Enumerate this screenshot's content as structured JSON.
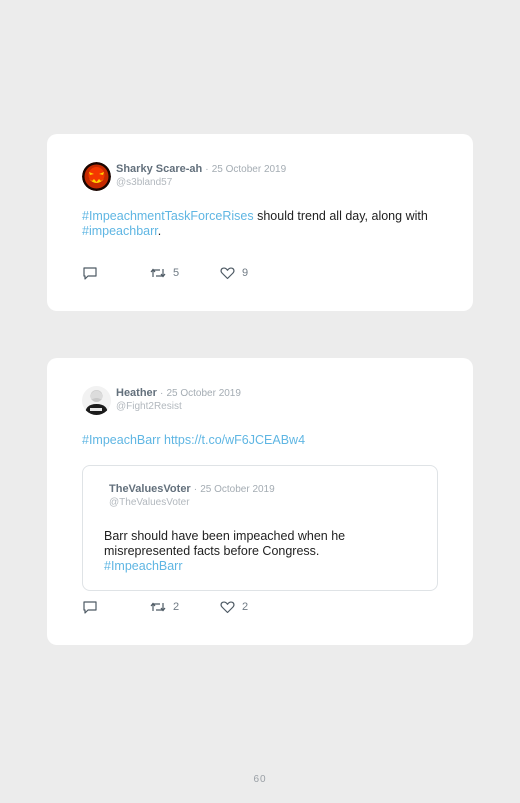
{
  "tweets": [
    {
      "author_name": "Sharky Scare-ah",
      "date": "25 October 2019",
      "handle": "@s3bland57",
      "text_parts": {
        "tag1": "#ImpeachmentTaskForceRises",
        "mid": " should trend all day, along with ",
        "tag2": "#impeachbarr",
        "end": "."
      },
      "replies": "",
      "retweets": "5",
      "likes": "9",
      "avatar_icon": "jack-o-lantern-avatar"
    },
    {
      "author_name": "Heather",
      "date": "25 October 2019",
      "handle": "@Fight2Resist",
      "text_parts": {
        "tag1": "#ImpeachBarr",
        "mid": " ",
        "link": "https://t.co/wF6JCEABw4"
      },
      "quoted": {
        "author_name": "TheValuesVoter",
        "date": "25 October 2019",
        "handle": "@TheValuesVoter",
        "text": "Barr should have been impeached when he misrepresented facts before Congress.",
        "tag": "#ImpeachBarr"
      },
      "replies": "",
      "retweets": "2",
      "likes": "2",
      "avatar_icon": "person-photo-avatar"
    }
  ],
  "separator": "·",
  "page_number": "60",
  "colors": {
    "background": "#ececec",
    "card": "#ffffff",
    "hashtag": "#5fb6e3",
    "name": "#63707c",
    "muted": "#a4acb3"
  }
}
